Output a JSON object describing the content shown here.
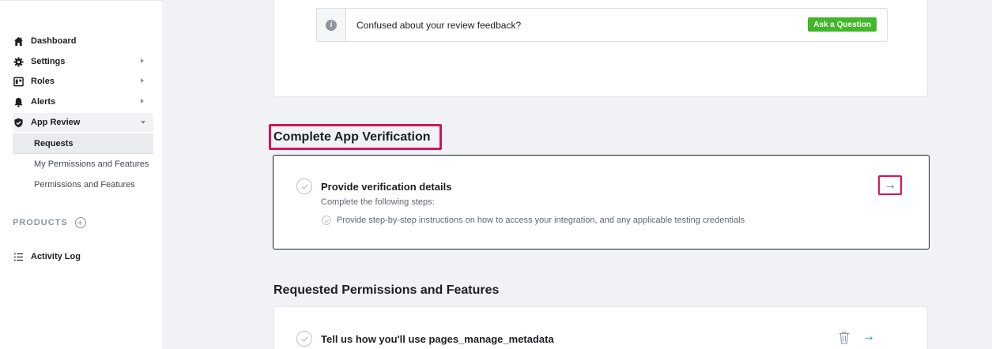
{
  "sidebar": {
    "items": [
      {
        "label": "Dashboard",
        "icon": "home-icon"
      },
      {
        "label": "Settings",
        "icon": "gear-icon"
      },
      {
        "label": "Roles",
        "icon": "roles-icon"
      },
      {
        "label": "Alerts",
        "icon": "bell-icon"
      },
      {
        "label": "App Review",
        "icon": "shield-check-icon"
      }
    ],
    "sub_items": [
      {
        "label": "Requests"
      },
      {
        "label": "My Permissions and Features"
      },
      {
        "label": "Permissions and Features"
      }
    ],
    "products_label": "PRODUCTS",
    "products_add": "+",
    "activity_log": "Activity Log"
  },
  "help": {
    "icon_glyph": "i",
    "text": "Confused about your review feedback?",
    "button": "Ask a Question"
  },
  "verification": {
    "title": "Complete App Verification",
    "item_title": "Provide verification details",
    "item_sub": "Complete the following steps:",
    "step": "Provide step-by-step instructions on how to access your integration, and any applicable testing credentials",
    "arrow": "→"
  },
  "permissions": {
    "title": "Requested Permissions and Features",
    "item_title": "Tell us how you'll use pages_manage_metadata",
    "arrow": "→"
  },
  "colors": {
    "highlight": "#d6125a",
    "accent": "#1877f2",
    "button_green": "#42b72a"
  }
}
